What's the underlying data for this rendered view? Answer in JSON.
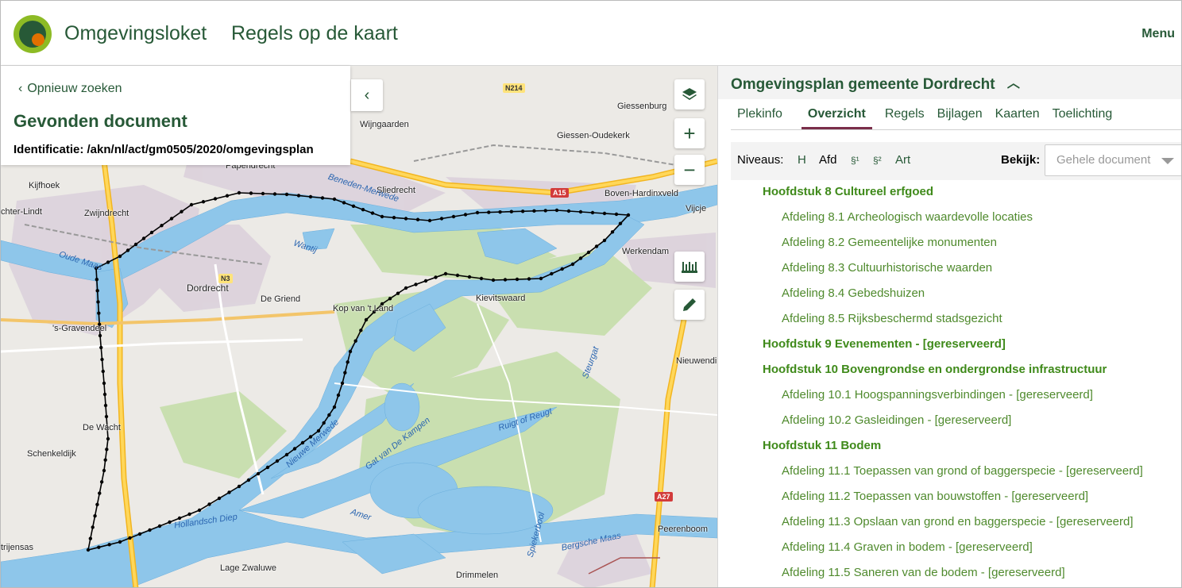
{
  "header": {
    "brand": "Omgevingsloket",
    "app_title": "Regels op de kaart",
    "menu_label": "Menu"
  },
  "search": {
    "back_label": "Opnieuw zoeken",
    "found_title": "Gevonden document",
    "identification": "Identificatie: /akn/nl/act/gm0505/2020/omgevingsplan"
  },
  "map": {
    "places": [
      "Wijngaarden",
      "Giessenburg",
      "Giessen-Oudekerk",
      "Papendrecht",
      "Sliedrecht",
      "Boven-Hardinxveld",
      "Kijfhoek",
      "Zwijndrecht",
      "Vijcje",
      "Werkendam",
      "Dordrecht",
      "De Griend",
      "Kop van 't Land",
      "Kievitswaard",
      "'s-Gravendeel",
      "Nieuwendi",
      "De Wacht",
      "Schenkeldijk",
      "Peerenboom",
      "Lage Zwaluwe",
      "Drimmelen",
      "trijensas",
      "chter-Lindt"
    ],
    "waters": [
      "Oude Maas",
      "Beneden-Merwede",
      "Wantij",
      "Nieuwe Merwede",
      "Gat van De Kampen",
      "Ruigt of Reugt",
      "Steurgat",
      "Hollandsch Diep",
      "Amer",
      "Spiekerbool",
      "Bergsche Maas"
    ],
    "roads": [
      "N214",
      "A15",
      "N3",
      "A27"
    ]
  },
  "controls": {
    "layers_icon": "layers-icon",
    "zoom_in": "+",
    "zoom_out": "−",
    "measure_icon": "ruler-icon",
    "draw_icon": "pencil-icon"
  },
  "panel": {
    "plan_title": "Omgevingsplan gemeente Dordrecht",
    "tabs": [
      "Plekinfo",
      "Overzicht",
      "Regels",
      "Bijlagen",
      "Kaarten",
      "Toelichting"
    ],
    "active_tab": "Overzicht",
    "levels_label": "Niveaus:",
    "levels": [
      "H",
      "Afd",
      "§¹",
      "§²",
      "Art"
    ],
    "bekijk_label": "Bekijk:",
    "select_value": "Gehele document"
  },
  "toc": [
    {
      "type": "h",
      "text": "Hoofdstuk 8 Cultureel erfgoed"
    },
    {
      "type": "a",
      "text": "Afdeling 8.1 Archeologisch waardevolle locaties"
    },
    {
      "type": "a",
      "text": "Afdeling 8.2 Gemeentelijke monumenten"
    },
    {
      "type": "a",
      "text": "Afdeling 8.3 Cultuurhistorische waarden"
    },
    {
      "type": "a",
      "text": "Afdeling 8.4 Gebedshuizen"
    },
    {
      "type": "a",
      "text": "Afdeling 8.5 Rijksbeschermd stadsgezicht"
    },
    {
      "type": "h",
      "text": "Hoofdstuk 9 Evenementen - [gereserveerd]"
    },
    {
      "type": "h",
      "text": "Hoofdstuk 10 Bovengrondse en ondergrondse infrastructuur"
    },
    {
      "type": "a",
      "text": "Afdeling 10.1 Hoogspanningsverbindingen - [gereserveerd]"
    },
    {
      "type": "a",
      "text": "Afdeling 10.2 Gasleidingen - [gereserveerd]"
    },
    {
      "type": "h",
      "text": "Hoofdstuk 11 Bodem"
    },
    {
      "type": "a",
      "text": "Afdeling 11.1 Toepassen van grond of baggerspecie - [gereserveerd]"
    },
    {
      "type": "a",
      "text": "Afdeling 11.2 Toepassen van bouwstoffen - [gereserveerd]"
    },
    {
      "type": "a",
      "text": "Afdeling 11.3 Opslaan van grond en baggerspecie - [gereserveerd]"
    },
    {
      "type": "a",
      "text": "Afdeling 11.4 Graven in bodem - [gereserveerd]"
    },
    {
      "type": "a",
      "text": "Afdeling 11.5 Saneren van de bodem - [gereserveerd]"
    }
  ]
}
